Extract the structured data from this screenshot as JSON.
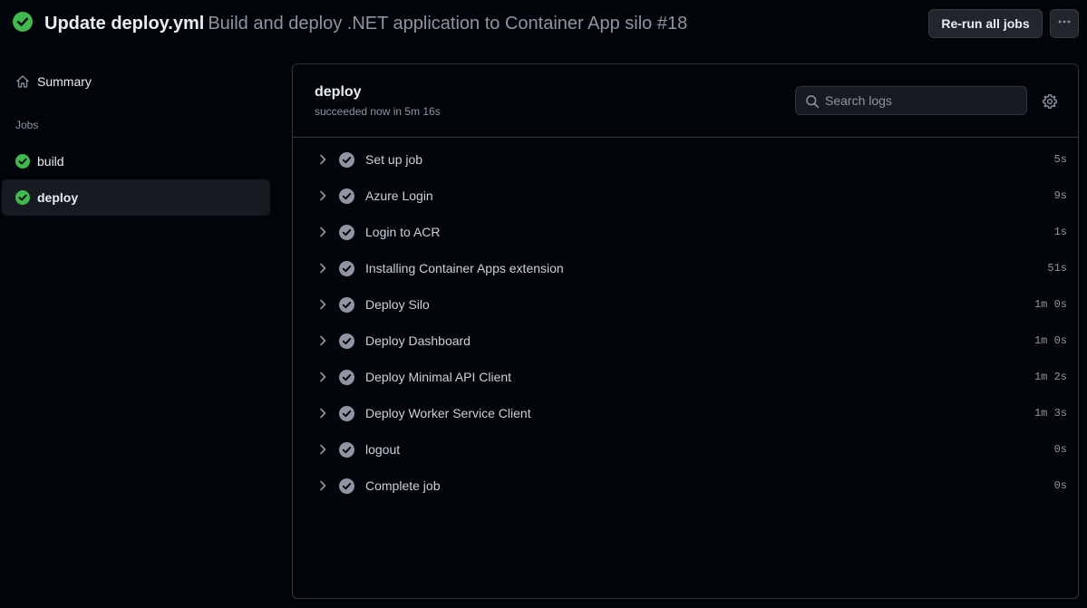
{
  "header": {
    "title_strong": "Update deploy.yml",
    "title_rest": "Build and deploy .NET application to Container App silo #18",
    "rerun_label": "Re-run all jobs",
    "more_icon": "kebab-horizontal-icon",
    "status_icon": "check-circle-fill-icon",
    "success_color": "#3fb950"
  },
  "sidebar": {
    "summary_label": "Summary",
    "summary_icon": "home-icon",
    "jobs_heading": "Jobs",
    "jobs": [
      {
        "label": "build",
        "icon": "check-circle-fill-icon",
        "selected": false
      },
      {
        "label": "deploy",
        "icon": "check-circle-fill-icon",
        "selected": true
      }
    ]
  },
  "main": {
    "job_title": "deploy",
    "job_subtitle": "succeeded now in 5m 16s",
    "search_placeholder": "Search logs",
    "settings_icon": "gear-icon",
    "steps": [
      {
        "name": "Set up job",
        "duration": "5s"
      },
      {
        "name": "Azure Login",
        "duration": "9s"
      },
      {
        "name": "Login to ACR",
        "duration": "1s"
      },
      {
        "name": "Installing Container Apps extension",
        "duration": "51s"
      },
      {
        "name": "Deploy Silo",
        "duration": "1m 0s"
      },
      {
        "name": "Deploy Dashboard",
        "duration": "1m 0s"
      },
      {
        "name": "Deploy Minimal API Client",
        "duration": "1m 2s"
      },
      {
        "name": "Deploy Worker Service Client",
        "duration": "1m 3s"
      },
      {
        "name": "logout",
        "duration": "0s"
      },
      {
        "name": "Complete job",
        "duration": "0s"
      }
    ]
  }
}
